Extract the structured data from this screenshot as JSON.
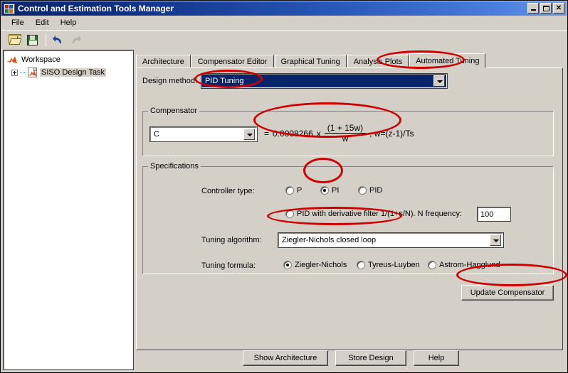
{
  "window": {
    "title": "Control and Estimation Tools Manager",
    "icon": "matlab-app-icon",
    "minimize_label": "_",
    "maximize_label": "maximize",
    "close_label": "✕"
  },
  "menu": {
    "items": [
      {
        "label": "File"
      },
      {
        "label": "Edit"
      },
      {
        "label": "Help"
      }
    ]
  },
  "toolbar": {
    "buttons": [
      {
        "name": "open-icon",
        "tooltip": "Open"
      },
      {
        "name": "save-icon",
        "tooltip": "Save"
      },
      {
        "name": "undo-icon",
        "tooltip": "Undo"
      },
      {
        "name": "redo-icon",
        "tooltip": "Redo"
      }
    ]
  },
  "tree": {
    "root": {
      "label": "Workspace",
      "icon": "matlab-icon"
    },
    "child": {
      "label": "SISO Design Task",
      "icon": "siso-task-icon",
      "expander": "+",
      "selected": true
    }
  },
  "tabs": [
    {
      "label": "Architecture",
      "active": false
    },
    {
      "label": "Compensator Editor",
      "active": false
    },
    {
      "label": "Graphical Tuning",
      "active": false
    },
    {
      "label": "Analysis Plots",
      "active": false
    },
    {
      "label": "Automated Tuning",
      "active": true
    }
  ],
  "design_method": {
    "label": "Design method:",
    "value": "PID Tuning",
    "selected": true
  },
  "compensator": {
    "group_title": "Compensator",
    "combo_value": "C",
    "equals": "=",
    "gain": "0.0008266",
    "times": "x",
    "numerator": "(1 + 15w)",
    "denominator": "w",
    "suffix": ", w=(z-1)/Ts"
  },
  "specifications": {
    "group_title": "Specifications",
    "controller_type": {
      "label": "Controller type:",
      "options": [
        {
          "label": "P",
          "checked": false
        },
        {
          "label": "PI",
          "checked": true
        },
        {
          "label": "PID",
          "checked": false
        }
      ],
      "filter_option": {
        "label": "PID with derivative filter 1/(1+s/N). N frequency:",
        "checked": false,
        "n_frequency_value": "100"
      }
    },
    "tuning_algorithm": {
      "label": "Tuning algorithm:",
      "value": "Ziegler-Nichols closed loop"
    },
    "tuning_formula": {
      "label": "Tuning formula:",
      "options": [
        {
          "label": "Ziegler-Nichols",
          "checked": true
        },
        {
          "label": "Tyreus-Luyben",
          "checked": false
        },
        {
          "label": "Astrom-Hagglund",
          "checked": false
        }
      ]
    }
  },
  "update_button": {
    "label": "Update Compensator"
  },
  "bottom_buttons": [
    {
      "label": "Show Architecture"
    },
    {
      "label": "Store Design"
    },
    {
      "label": "Help"
    }
  ],
  "annotations": {
    "color": "#d00000",
    "ellipses": [
      "automated-tuning-tab",
      "pid-tuning-value",
      "compensator-formula",
      "pi-radio",
      "tuning-algorithm-value",
      "update-compensator-button"
    ]
  }
}
